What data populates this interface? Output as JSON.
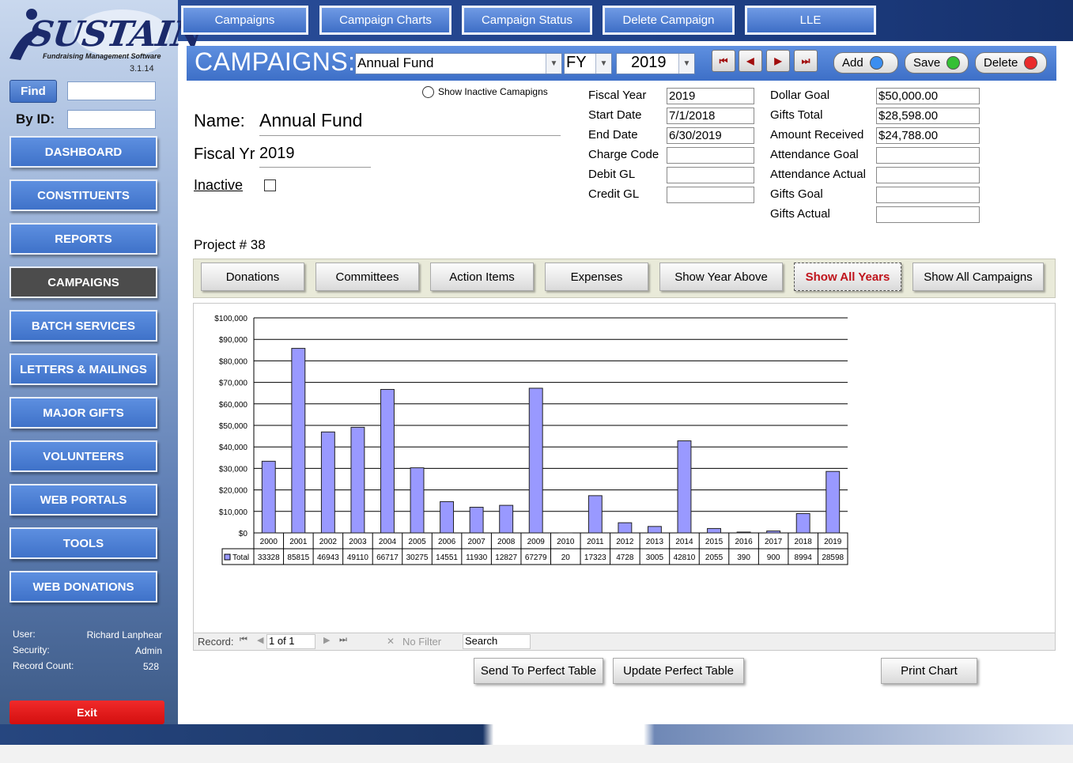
{
  "app": {
    "logo_text": "SUSTAIN",
    "logo_subtitle": "Fundraising Management Software",
    "version": "3.1.14"
  },
  "sidebar": {
    "find_label": "Find",
    "find_value": "",
    "byid_label": "By ID:",
    "byid_value": "",
    "nav": [
      {
        "label": "DASHBOARD",
        "active": false
      },
      {
        "label": "CONSTITUENTS",
        "active": false
      },
      {
        "label": "REPORTS",
        "active": false
      },
      {
        "label": "CAMPAIGNS",
        "active": true
      },
      {
        "label": "BATCH SERVICES",
        "active": false
      },
      {
        "label": "LETTERS & MAILINGS",
        "active": false
      },
      {
        "label": "MAJOR GIFTS",
        "active": false
      },
      {
        "label": "VOLUNTEERS",
        "active": false
      },
      {
        "label": "WEB PORTALS",
        "active": false
      },
      {
        "label": "TOOLS",
        "active": false
      },
      {
        "label": "WEB DONATIONS",
        "active": false
      }
    ],
    "user_label": "User:",
    "user_value": "Richard Lanphear",
    "security_label": "Security:",
    "security_value": "Admin",
    "count_label": "Record Count:",
    "count_value": "528",
    "exit_label": "Exit"
  },
  "top_tabs": [
    "Campaigns",
    "Campaign Charts",
    "Campaign Status",
    "Delete Campaign",
    "LLE"
  ],
  "header": {
    "title": "CAMPAIGNS:",
    "campaign_select": "Annual Fund",
    "type_select": "FY",
    "year_select": "2019",
    "nav_first": "⏮",
    "nav_prev": "◀",
    "nav_next": "▶",
    "nav_last": "⏭",
    "add_label": "Add",
    "save_label": "Save",
    "delete_label": "Delete",
    "colors": {
      "add": "#3b8ef0",
      "save": "#35c035",
      "delete": "#ea2b2b"
    }
  },
  "form": {
    "show_inactive_label": "Show Inactive Camapigns",
    "name_label": "Name:",
    "name_value": "Annual Fund",
    "fiscal_label": "Fiscal Yr",
    "fiscal_value": "2019",
    "inactive_label": "Inactive",
    "project_label": "Project # 38",
    "mid_fields": [
      {
        "label": "Fiscal Year",
        "value": "2019"
      },
      {
        "label": "Start Date",
        "value": "7/1/2018"
      },
      {
        "label": "End Date",
        "value": "6/30/2019"
      },
      {
        "label": "Charge Code",
        "value": ""
      },
      {
        "label": "Debit GL",
        "value": ""
      },
      {
        "label": "Credit GL",
        "value": ""
      }
    ],
    "right_fields": [
      {
        "label": "Dollar Goal",
        "value": "$50,000.00"
      },
      {
        "label": "Gifts Total",
        "value": "$28,598.00"
      },
      {
        "label": "Amount Received",
        "value": "$24,788.00"
      },
      {
        "label": "Attendance Goal",
        "value": ""
      },
      {
        "label": "Attendance Actual",
        "value": ""
      },
      {
        "label": "Gifts Goal",
        "value": ""
      },
      {
        "label": "Gifts Actual",
        "value": ""
      }
    ]
  },
  "sub_tabs": [
    {
      "label": "Donations",
      "selected": false
    },
    {
      "label": "Committees",
      "selected": false
    },
    {
      "label": "Action Items",
      "selected": false
    },
    {
      "label": "Expenses",
      "selected": false
    },
    {
      "label": "Show Year Above",
      "selected": false
    },
    {
      "label": "Show All Years",
      "selected": true
    },
    {
      "label": "Show All Campaigns",
      "selected": false
    }
  ],
  "chart_data": {
    "type": "bar",
    "categories": [
      "2000",
      "2001",
      "2002",
      "2003",
      "2004",
      "2005",
      "2006",
      "2007",
      "2008",
      "2009",
      "2010",
      "2011",
      "2012",
      "2013",
      "2014",
      "2015",
      "2016",
      "2017",
      "2018",
      "2019"
    ],
    "series": [
      {
        "name": "Total",
        "values": [
          33328,
          85815,
          46943,
          49110,
          66717,
          30275,
          14551,
          11930,
          12827,
          67279,
          20,
          17323,
          4728,
          3005,
          42810,
          2055,
          390,
          900,
          8994,
          28598
        ]
      }
    ],
    "y_ticks": [
      "$0",
      "$10,000",
      "$20,000",
      "$30,000",
      "$40,000",
      "$50,000",
      "$60,000",
      "$70,000",
      "$80,000",
      "$90,000",
      "$100,000"
    ],
    "ylim": [
      0,
      100000
    ],
    "grid": true,
    "legend": "data-table",
    "bar_color": "#9999ff"
  },
  "record_nav": {
    "record_label": "Record:",
    "position": "1 of 1",
    "filter_label": "No Filter",
    "search_label": "Search"
  },
  "bottom_buttons": {
    "send": "Send To Perfect Table",
    "update": "Update Perfect Table",
    "print": "Print Chart"
  }
}
